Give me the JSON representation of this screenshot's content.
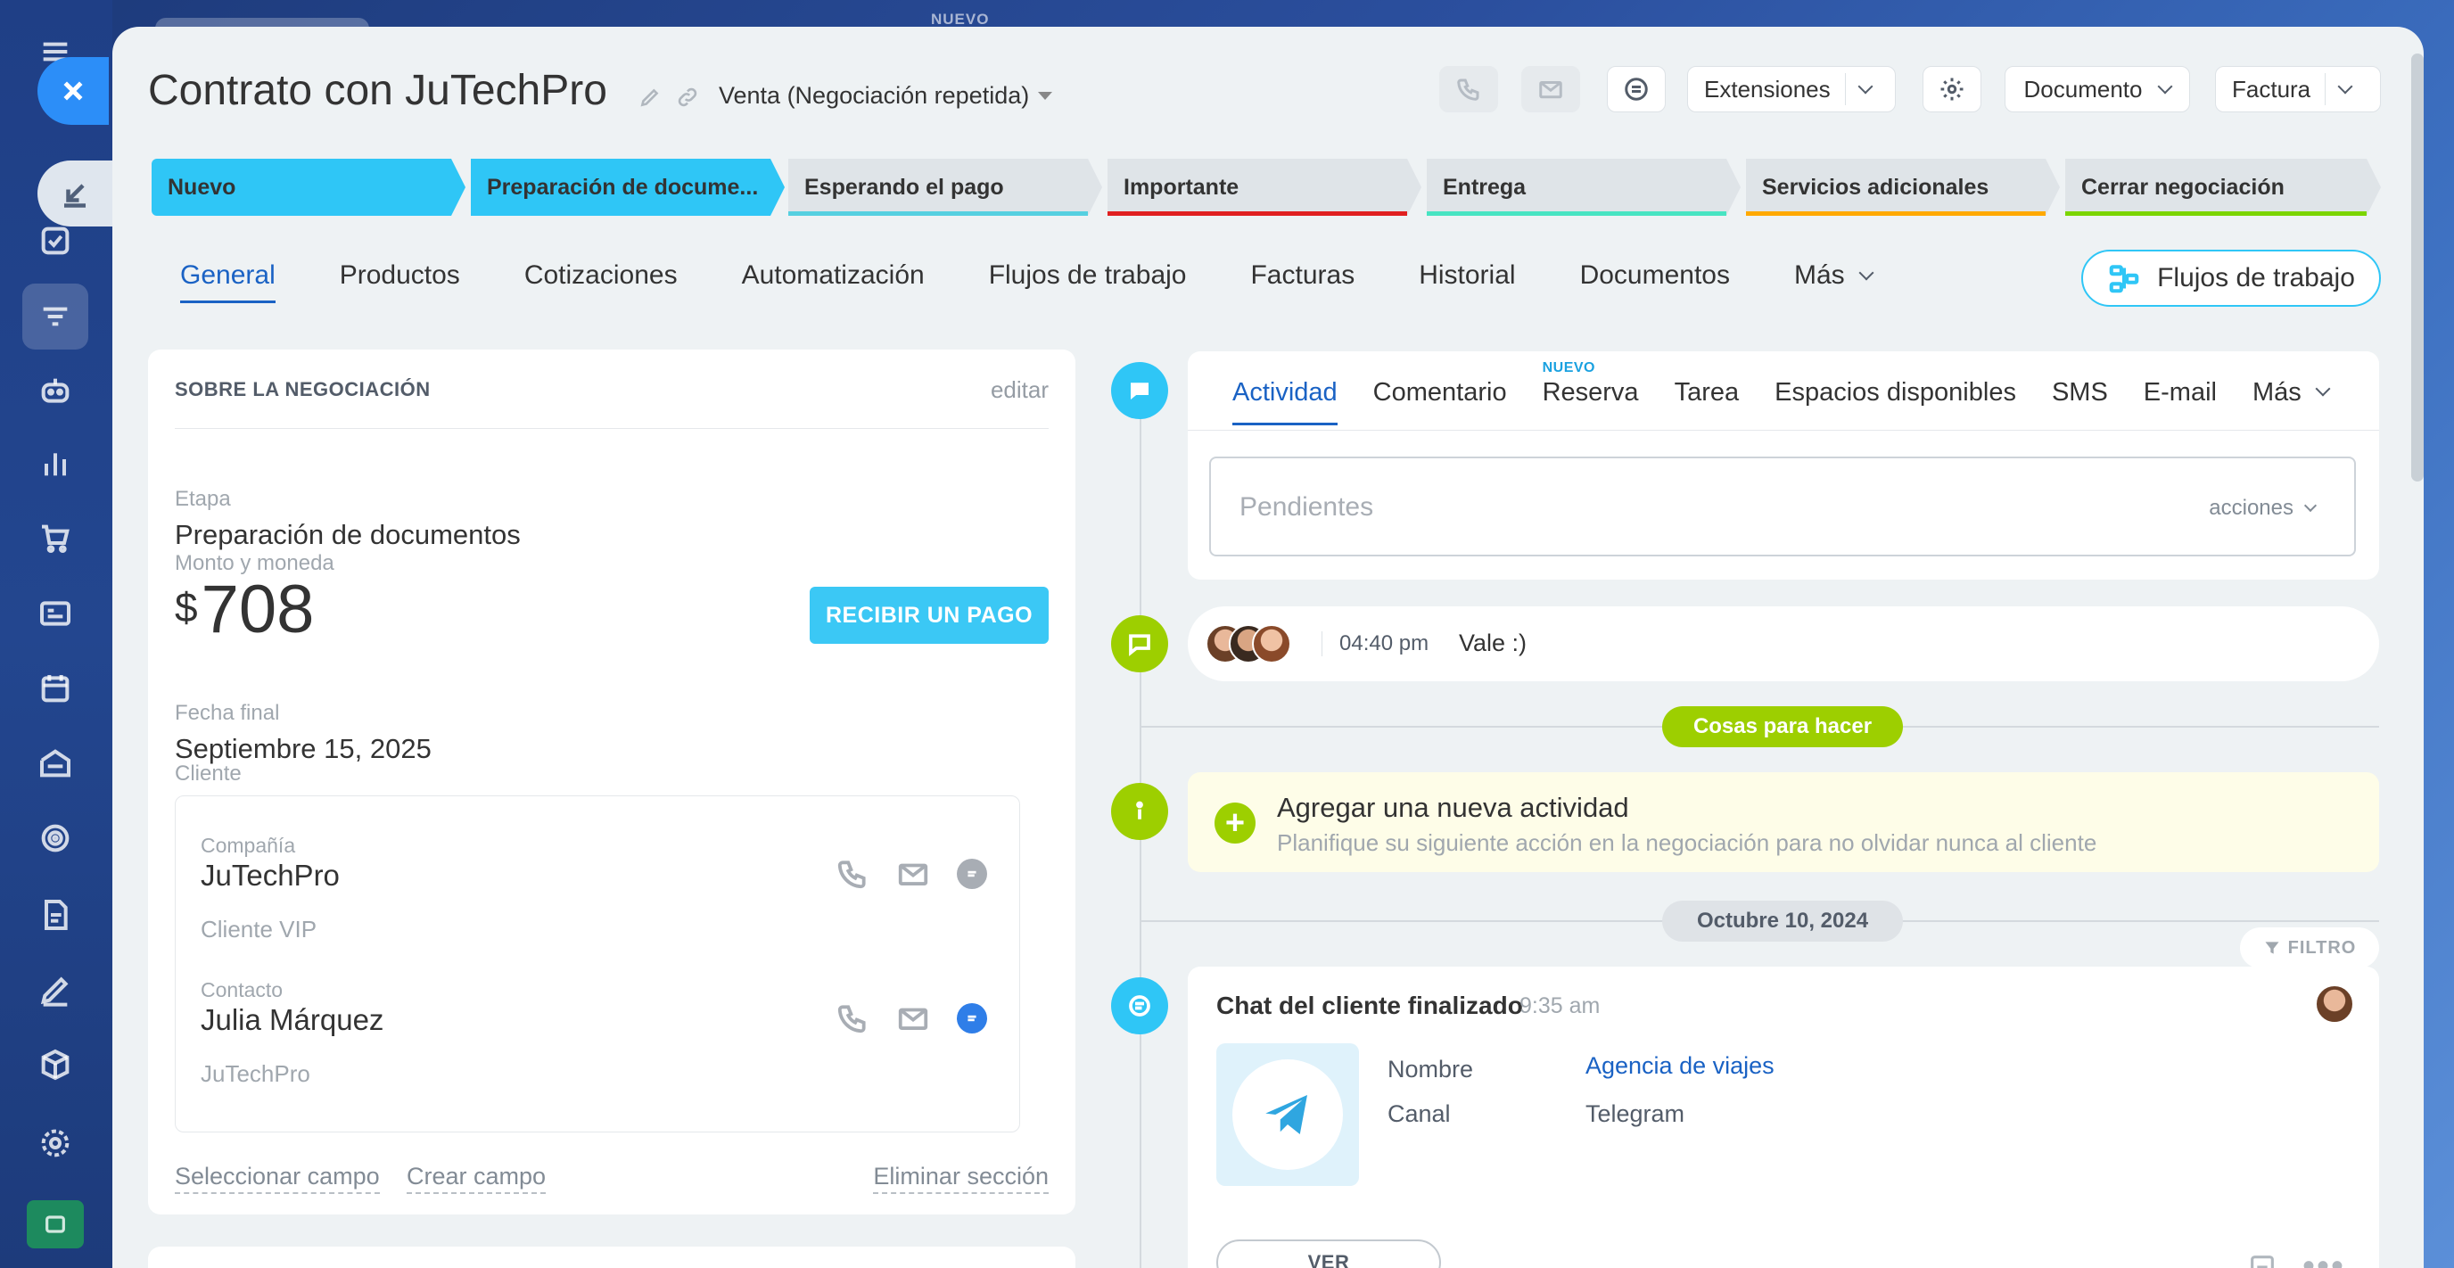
{
  "rail": {
    "top_label": "NUEVO"
  },
  "header": {
    "title": "Contrato con JuTechPro",
    "pipeline": "Venta (Negociación repetida)",
    "extensions_label": "Extensiones",
    "document_label": "Documento",
    "invoice_label": "Factura"
  },
  "stages": [
    {
      "label": "Nuevo",
      "color": "#2fc6f6"
    },
    {
      "label": "Preparación de docume...",
      "color": "#2fc6f6"
    },
    {
      "label": "Esperando el pago",
      "color": "#55d0e0"
    },
    {
      "label": "Importante",
      "color": "#e02020"
    },
    {
      "label": "Entrega",
      "color": "#47e4c2"
    },
    {
      "label": "Servicios adicionales",
      "color": "#ffa900"
    },
    {
      "label": "Cerrar negociación",
      "color": "#7bd500"
    }
  ],
  "tabs": [
    "General",
    "Productos",
    "Cotizaciones",
    "Automatización",
    "Flujos de trabajo",
    "Facturas",
    "Historial",
    "Documentos",
    "Más"
  ],
  "workflows_button": "Flujos de trabajo",
  "deal": {
    "section_title": "SOBRE LA NEGOCIACIÓN",
    "edit_label": "editar",
    "stage_label": "Etapa",
    "stage_value": "Preparación de documentos",
    "amount_label": "Monto y moneda",
    "currency": "$",
    "amount": "708",
    "pay_button": "RECIBIR UN PAGO",
    "end_date_label": "Fecha final",
    "end_date": "Septiembre 15, 2025",
    "client_label": "Cliente",
    "company_label": "Compañía",
    "company_name": "JuTechPro",
    "company_sub": "Cliente VIP",
    "contact_label": "Contacto",
    "contact_name": "Julia Márquez",
    "contact_sub": "JuTechPro",
    "select_field": "Seleccionar campo",
    "create_field": "Crear campo",
    "delete_section": "Eliminar sección"
  },
  "activity": {
    "tabs": [
      "Actividad",
      "Comentario",
      "Reserva",
      "Tarea",
      "Espacios disponibles",
      "SMS",
      "E-mail",
      "Más"
    ],
    "new_tag": "NUEVO",
    "pending_placeholder": "Pendientes",
    "actions_label": "acciones",
    "comment_time": "04:40 pm",
    "comment_text": "Vale :)",
    "todo_pill": "Cosas para hacer",
    "add_activity_title": "Agregar una nueva actividad",
    "add_activity_sub": "Planifique su siguiente acción en la negociación para no olvidar nunca al cliente",
    "date_pill": "Octubre 10, 2024",
    "filter_label": "FILTRO",
    "chat_title": "Chat del cliente finalizado",
    "chat_time": "9:35 am",
    "name_label": "Nombre",
    "name_value": "Agencia de viajes",
    "channel_label": "Canal",
    "channel_value": "Telegram",
    "view_button": "VER"
  }
}
